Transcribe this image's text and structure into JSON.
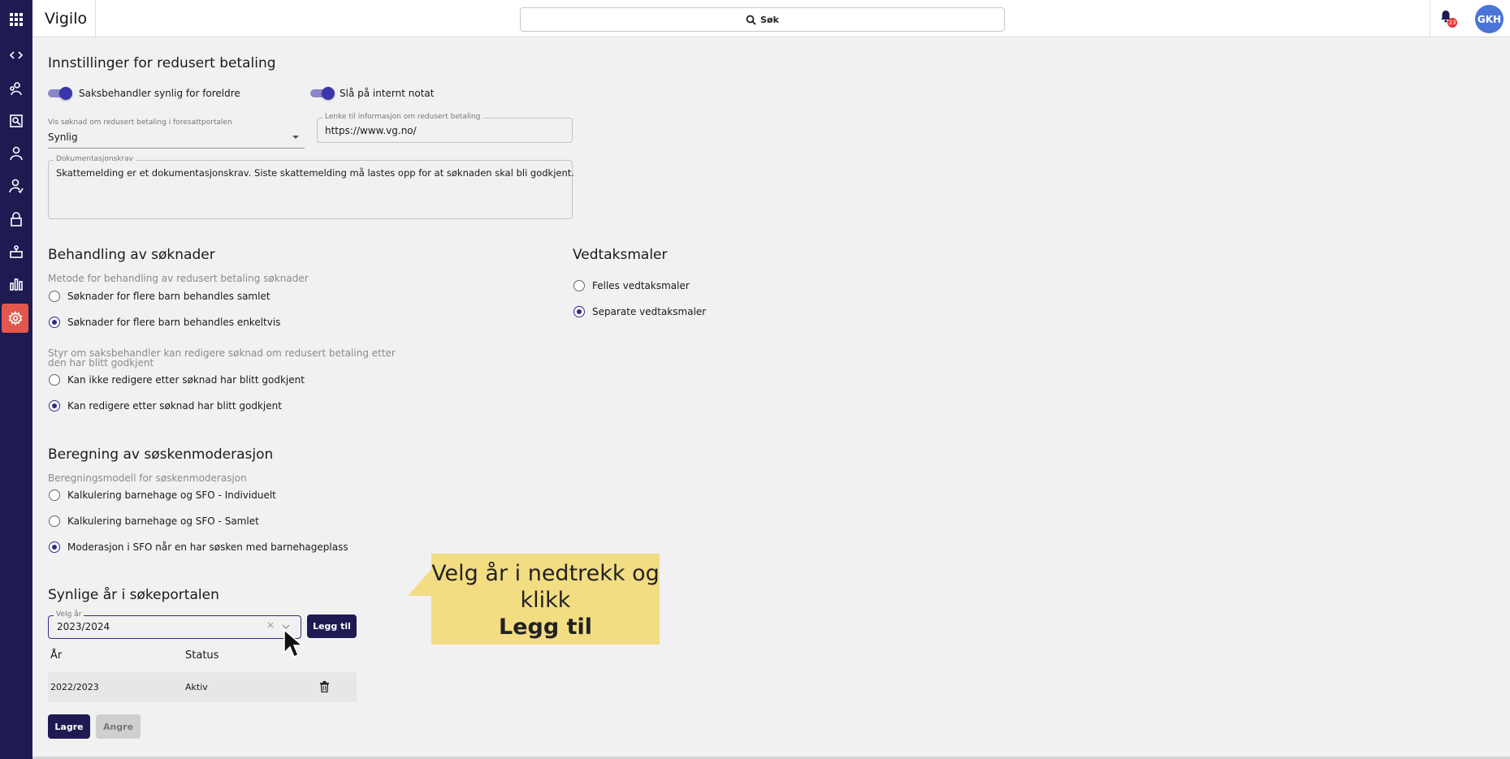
{
  "app": {
    "title": "Vigilo"
  },
  "header": {
    "search_label": "Søk",
    "notification_count": "23",
    "user_initials": "GKH"
  },
  "sidebar": {
    "items": [
      {
        "name": "apps-grid-icon"
      },
      {
        "name": "code-icon"
      },
      {
        "name": "children-icon"
      },
      {
        "name": "report-icon"
      },
      {
        "name": "person-icon"
      },
      {
        "name": "person-check-icon"
      },
      {
        "name": "lock-icon"
      },
      {
        "name": "building-icon"
      },
      {
        "name": "bar-chart-icon"
      },
      {
        "name": "gear-icon",
        "active": true
      }
    ]
  },
  "reduced_payment": {
    "title": "Innstillinger for redusert betaling",
    "toggle_visible_label": "Saksbehandler synlig for foreldre",
    "toggle_note_label": "Slå på internt notat",
    "show_application_label": "Vis søknad om redusert betaling i foresattportalen",
    "show_application_value": "Synlig",
    "info_link_label": "Lenke til informasjon om redusert betaling",
    "info_link_value": "https://www.vg.no/",
    "documentation_label": "Dokumentasjonskrav",
    "documentation_value": "Skattemelding er et dokumentasjonskrav. Siste skattemelding må lastes opp for at søknaden skal bli godkjent."
  },
  "processing": {
    "title": "Behandling av søknader",
    "method_label": "Metode for behandling av redusert betaling søknader",
    "method_options": [
      "Søknader for flere barn behandles samlet",
      "Søknader for flere barn behandles enkeltvis"
    ],
    "method_selected": 1,
    "edit_label_line1": "Styr om saksbehandler kan redigere søknad om redusert betaling etter",
    "edit_label_line2": "den har blitt godkjent",
    "edit_options": [
      "Kan ikke redigere etter søknad har blitt godkjent",
      "Kan redigere etter søknad har blitt godkjent"
    ],
    "edit_selected": 1
  },
  "templates": {
    "title": "Vedtaksmaler",
    "options": [
      "Felles vedtaksmaler",
      "Separate vedtaksmaler"
    ],
    "selected": 1
  },
  "sibling": {
    "title": "Beregning av søskenmoderasjon",
    "model_label": "Beregningsmodell for søskenmoderasjon",
    "options": [
      "Kalkulering barnehage og SFO - Individuelt",
      "Kalkulering barnehage og SFO - Samlet",
      "Moderasjon i SFO når en har søsken med barnehageplass"
    ],
    "selected": 2
  },
  "years": {
    "title": "Synlige år i søkeportalen",
    "select_label": "Velg år",
    "select_value": "2023/2024",
    "add_button": "Legg til",
    "col_year": "År",
    "col_status": "Status",
    "rows": [
      {
        "year": "2022/2023",
        "status": "Aktiv"
      }
    ]
  },
  "actions": {
    "save": "Lagre",
    "cancel": "Angre"
  },
  "callout": {
    "line1": "Velg år i nedtrekk og",
    "line2": "klikk",
    "line3": "Legg til"
  }
}
